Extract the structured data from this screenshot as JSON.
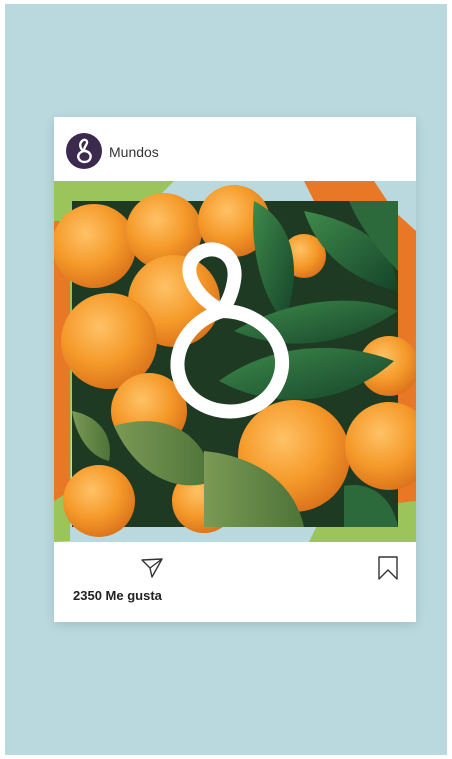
{
  "post": {
    "username": "Mundos",
    "likes_text": "2350 Me gusta"
  },
  "icons": {
    "avatar": "brand-logo-icon",
    "media_logo": "brand-logo-icon",
    "send": "paper-plane-icon",
    "save": "bookmark-icon"
  },
  "colors": {
    "background": "#b9d9df",
    "avatar": "#3b2a4e",
    "orange_accent": "#e97826",
    "green_accent": "#9bc45a"
  }
}
